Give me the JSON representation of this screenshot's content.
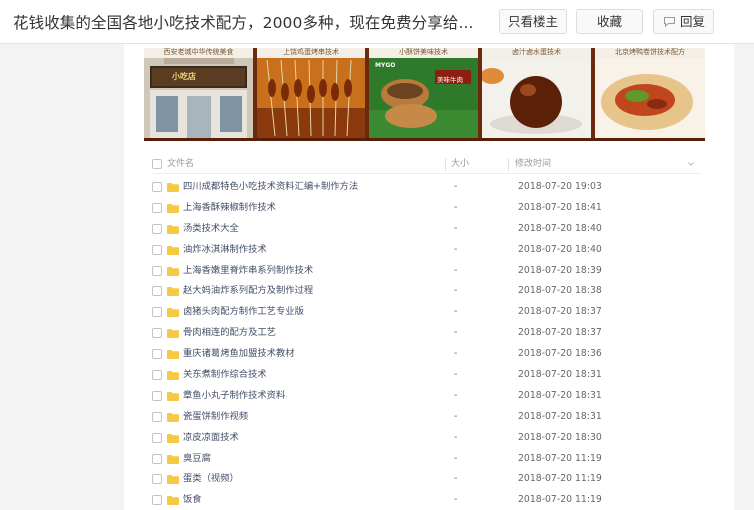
{
  "post": {
    "title": "花钱收集的全国各地小吃技术配方，2000多种，现在免费分享给..."
  },
  "actions": {
    "only_op": "只看楼主",
    "favorite": "收藏",
    "reply": "回复"
  },
  "banner": {
    "tiles": [
      {
        "caption": "西安老城中华传统美食"
      },
      {
        "caption": "上饶鸡蛋烤串技术"
      },
      {
        "caption": "小酥饼美味技术"
      },
      {
        "caption": "卤汁卤水蛋技术"
      },
      {
        "caption": "北京烤鸭卷饼技术配方"
      }
    ],
    "shop_sign": "小吃店",
    "brand_text": "MYGO",
    "sub_text": "美味牛肉"
  },
  "filelist": {
    "headers": {
      "name": "文件名",
      "size": "大小",
      "time": "修改时间"
    },
    "rows": [
      {
        "name": "四川成都特色小吃技术资料汇编+制作方法",
        "size": "-",
        "time": "2018-07-20 19:03"
      },
      {
        "name": "上海香酥辣椒制作技术",
        "size": "-",
        "time": "2018-07-20 18:41"
      },
      {
        "name": "汤类技术大全",
        "size": "-",
        "time": "2018-07-20 18:40"
      },
      {
        "name": "油炸冰淇淋制作技术",
        "size": "-",
        "time": "2018-07-20 18:40"
      },
      {
        "name": "上海香嫩里脊炸串系列制作技术",
        "size": "-",
        "time": "2018-07-20 18:39"
      },
      {
        "name": "赵大妈油炸系列配方及制作过程",
        "size": "-",
        "time": "2018-07-20 18:38"
      },
      {
        "name": "卤猪头肉配方制作工艺专业版",
        "size": "-",
        "time": "2018-07-20 18:37"
      },
      {
        "name": "骨肉相连的配方及工艺",
        "size": "-",
        "time": "2018-07-20 18:37"
      },
      {
        "name": "重庆诸葛烤鱼加盟技术教材",
        "size": "-",
        "time": "2018-07-20 18:36"
      },
      {
        "name": "关东煮制作综合技术",
        "size": "-",
        "time": "2018-07-20 18:31"
      },
      {
        "name": "章鱼小丸子制作技术资料",
        "size": "-",
        "time": "2018-07-20 18:31"
      },
      {
        "name": "瓷蛋饼制作视频",
        "size": "-",
        "time": "2018-07-20 18:31"
      },
      {
        "name": "凉皮凉面技术",
        "size": "-",
        "time": "2018-07-20 18:30"
      },
      {
        "name": "臭豆腐",
        "size": "-",
        "time": "2018-07-20 11:19"
      },
      {
        "name": "蛋类（视频）",
        "size": "-",
        "time": "2018-07-20 11:19"
      },
      {
        "name": "饭食",
        "size": "-",
        "time": "2018-07-20 11:19"
      }
    ]
  },
  "colors": {
    "folder": "#f7c844",
    "link_text": "#424e67",
    "banner_frame": "#6b2a0e"
  }
}
